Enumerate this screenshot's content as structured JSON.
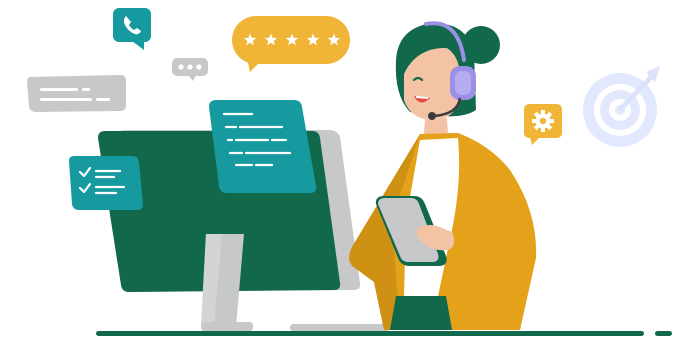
{
  "scene": {
    "kind": "illustration",
    "icons": {
      "phone": "phone-icon",
      "rating": "star-rating-icon",
      "gear": "gear-icon",
      "target": "target-icon",
      "typing": "typing-dots-icon",
      "checklist": "checklist-icon",
      "headset": "headset-icon",
      "tablet": "tablet-icon"
    },
    "rating": {
      "stars": 5
    },
    "colors": {
      "primary_green": "#12684a",
      "teal": "#169aa0",
      "mustard": "#d9a41e",
      "jacket": "#e3a21a",
      "gray": "#c7c8ca",
      "headset_purple": "#9c8fe6",
      "target_blue": "#dfe6fd",
      "skin": "#f4c2a5"
    }
  }
}
